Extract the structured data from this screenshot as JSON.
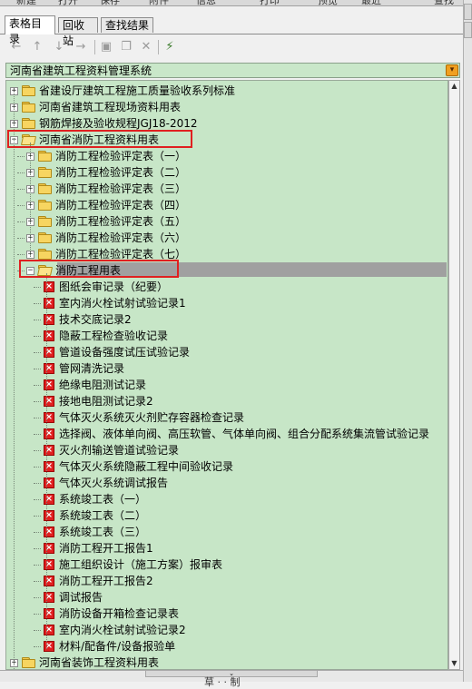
{
  "top_menu_fragments": [
    "新建",
    "打开",
    "保存",
    "附件",
    "信息",
    "打印",
    "预览",
    "最近",
    "查找"
  ],
  "tabs": [
    "表格目录",
    "回收站",
    "查找结果"
  ],
  "toolbar_icons": [
    "arrow-left-icon",
    "arrow-up-icon",
    "arrow-down-icon",
    "arrow-right-icon",
    "new-folder-icon",
    "copy-icon",
    "delete-icon",
    "filter-icon"
  ],
  "library": {
    "selected": "河南省建筑工程资料管理系统",
    "dropdown_icon": "chevron-down-icon"
  },
  "tree": {
    "level0": [
      {
        "label": "省建设厅建筑工程施工质量验收系列标准",
        "expanded": false
      },
      {
        "label": "河南省建筑工程现场资料用表",
        "expanded": false
      },
      {
        "label": "钢筋焊接及验收规程JGJ18-2012",
        "expanded": false
      },
      {
        "label": "河南省消防工程资料用表",
        "expanded": true
      },
      {
        "label": "河南省装饰工程资料用表",
        "expanded": false
      }
    ],
    "fire_children": [
      {
        "label": "消防工程检验评定表（一）"
      },
      {
        "label": "消防工程检验评定表（二）"
      },
      {
        "label": "消防工程检验评定表（三）"
      },
      {
        "label": "消防工程检验评定表（四）"
      },
      {
        "label": "消防工程检验评定表（五）"
      },
      {
        "label": "消防工程检验评定表（六）"
      },
      {
        "label": "消防工程检验评定表（七）"
      },
      {
        "label": "消防工程用表",
        "expanded": true,
        "selected": true
      }
    ],
    "forms": [
      "图纸会审记录（纪要）",
      "室内消火栓试射试验记录1",
      "技术交底记录2",
      "隐蔽工程检查验收记录",
      "管道设备强度试压试验记录",
      "管网清洗记录",
      "绝缘电阻测试记录",
      "接地电阻测试记录2",
      "气体灭火系统灭火剂贮存容器检查记录",
      "选择阀、液体单向阀、高压软管、气体单向阀、组合分配系统集流管试验记录",
      "灭火剂输送管道试验记录",
      "气体灭火系统隐蔽工程中间验收记录",
      "气体灭火系统调试报告",
      "系统竣工表（一）",
      "系统竣工表（二）",
      "系统竣工表（三）",
      "消防工程开工报告1",
      "施工组织设计（施工方案）报审表",
      "消防工程开工报告2",
      "调试报告",
      "消防设备开箱检查记录表",
      "室内消火栓试射试验记录2",
      "材料/配备件/设备报验单"
    ]
  },
  "status_text": "草  ·  ·  制",
  "colors": {
    "tree_bg": "#c7e6c7",
    "highlight_border": "#e02020",
    "selection": "#a0a0a0",
    "doc_icon": "#e02020"
  }
}
